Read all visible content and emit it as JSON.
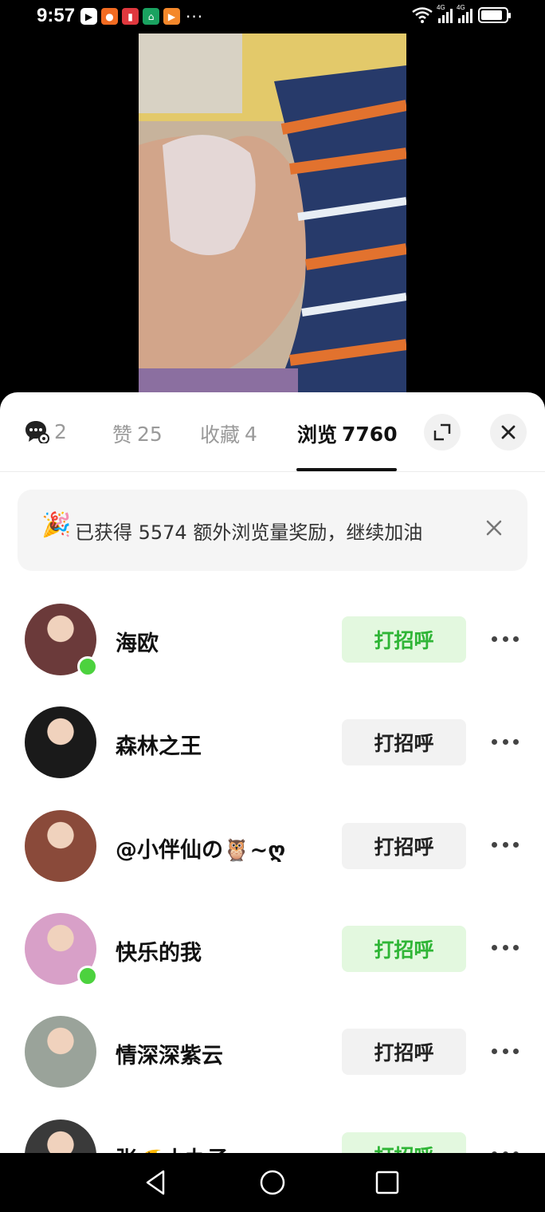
{
  "status_bar": {
    "time": "9:57",
    "more": "···",
    "network_tag": "4G",
    "notification_icons": [
      "video-play-icon",
      "orange-app-icon",
      "red-book-icon",
      "green-home-icon",
      "orange-play-icon"
    ],
    "system_icons": [
      "wifi-icon",
      "signal-4g-icon",
      "signal-4g-icon",
      "battery-icon"
    ],
    "battery_level": 0.85
  },
  "tabs": {
    "comments_count": "2",
    "likes_label": "赞",
    "likes_count": "25",
    "favorites_label": "收藏",
    "favorites_count": "4",
    "views_label": "浏览",
    "views_count": "7760",
    "active_tab": "views"
  },
  "banner": {
    "emoji": "🎉",
    "text": "已获得 5574 额外浏览量奖励，继续加油"
  },
  "viewers": [
    {
      "name": "海欧",
      "button": "打招呼",
      "highlight": true,
      "online": true,
      "avatar_color": "#6b3a3a"
    },
    {
      "name": "森林之王",
      "button": "打招呼",
      "highlight": false,
      "online": false,
      "avatar_color": "#1a1a1a"
    },
    {
      "name": "@小伴仙の🦉~ღ",
      "button": "打招呼",
      "highlight": false,
      "online": false,
      "avatar_color": "#8a4a3a"
    },
    {
      "name": "快乐的我",
      "button": "打招呼",
      "highlight": true,
      "online": true,
      "avatar_color": "#d8a0c8"
    },
    {
      "name": "情深深紫云",
      "button": "打招呼",
      "highlight": false,
      "online": false,
      "avatar_color": "#9aa39a"
    },
    {
      "name": "张🐠小丸子",
      "button": "打招呼",
      "highlight": true,
      "online": false,
      "avatar_color": "#3a3a3a"
    }
  ],
  "colors": {
    "accent_green": "#2fb536",
    "green_bg": "#e3f8df",
    "online_dot": "#4cd23e"
  },
  "nav": [
    "back-icon",
    "home-icon",
    "recents-icon"
  ]
}
